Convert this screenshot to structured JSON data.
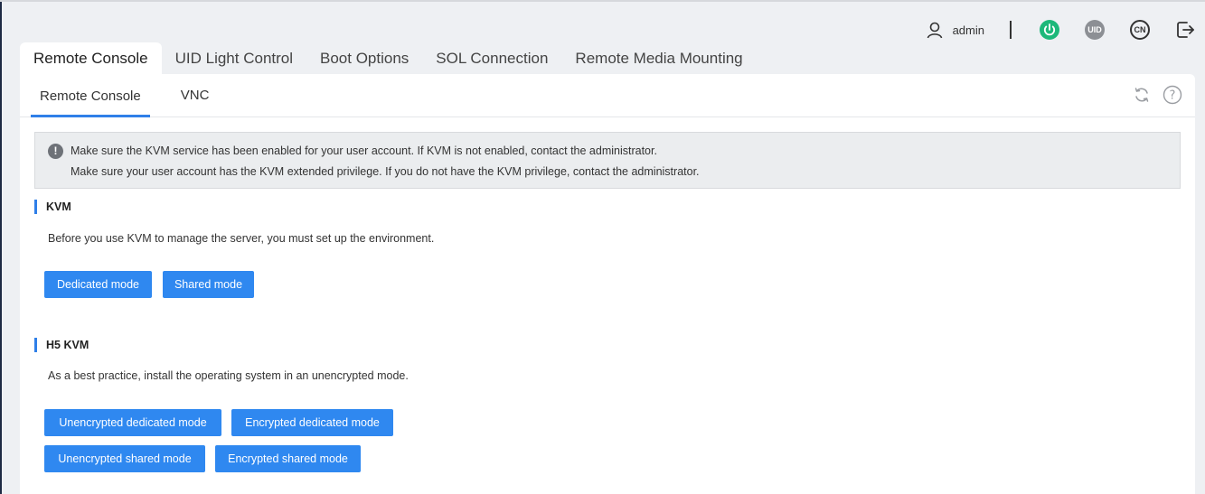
{
  "header": {
    "username": "admin",
    "icons": [
      "user-icon",
      "power-icon",
      "uid-icon",
      "language-icon",
      "logout-icon"
    ],
    "uid_label": "UID",
    "lang_label": "CN",
    "power_color": "#1db87a"
  },
  "main_tabs": [
    {
      "label": "Remote Console",
      "active": true
    },
    {
      "label": "UID Light Control",
      "active": false
    },
    {
      "label": "Boot Options",
      "active": false
    },
    {
      "label": "SOL Connection",
      "active": false
    },
    {
      "label": "Remote Media Mounting",
      "active": false
    }
  ],
  "sub_tabs": [
    {
      "label": "Remote Console",
      "active": true
    },
    {
      "label": "VNC",
      "active": false
    }
  ],
  "notice": {
    "line1": "Make sure the KVM service has been enabled for your user account. If KVM is not enabled, contact the administrator.",
    "line2": "Make sure your user account has the KVM extended privilege. If you do not have the KVM privilege, contact the administrator."
  },
  "kvm": {
    "title": "KVM",
    "description": "Before you use KVM to manage the server, you must set up the environment.",
    "buttons": [
      "Dedicated mode",
      "Shared mode"
    ]
  },
  "h5kvm": {
    "title": "H5 KVM",
    "description": "As a best practice, install the operating system in an unencrypted mode.",
    "buttons": [
      "Unencrypted dedicated mode",
      "Encrypted dedicated mode",
      "Unencrypted shared mode",
      "Encrypted shared mode"
    ]
  },
  "colors": {
    "accent": "#2f7fe8",
    "button": "#2f88f0"
  }
}
